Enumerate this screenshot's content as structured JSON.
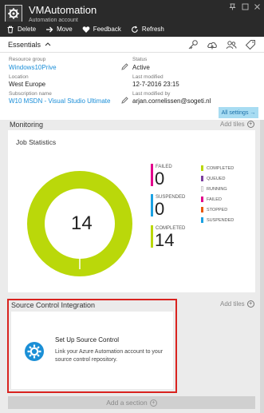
{
  "header": {
    "title": "VMAutomation",
    "subtitle": "Automation account",
    "toolbar": [
      {
        "label": "Delete",
        "icon": "trash-icon"
      },
      {
        "label": "Move",
        "icon": "arrow-right-icon"
      },
      {
        "label": "Feedback",
        "icon": "heart-icon"
      },
      {
        "label": "Refresh",
        "icon": "refresh-icon"
      }
    ]
  },
  "essentials": {
    "label": "Essentials",
    "resource_group_label": "Resource group",
    "resource_group": "Windows10Prive",
    "location_label": "Location",
    "location": "West Europe",
    "subscription_label": "Subscription name",
    "subscription": "W10 MSDN - Visual Studio Ultimate",
    "status_label": "Status",
    "status": "Active",
    "last_modified_label": "Last modified",
    "last_modified": "12-7-2016 23:15",
    "last_modified_by_label": "Last modified by",
    "last_modified_by": "arjan.cornelissen@sogeti.nl",
    "all_settings": "All settings →"
  },
  "monitoring": {
    "title": "Monitoring",
    "add_tiles": "Add tiles",
    "job_statistics": {
      "title": "Job Statistics",
      "total": "14",
      "stats": [
        {
          "label": "FAILED",
          "value": "0",
          "color": "#e3008c"
        },
        {
          "label": "SUSPENDED",
          "value": "0",
          "color": "#1ba1e2"
        },
        {
          "label": "COMPLETED",
          "value": "14",
          "color": "#bad80a"
        }
      ],
      "legend": [
        {
          "label": "COMPLETED",
          "color": "#bad80a"
        },
        {
          "label": "QUEUED",
          "color": "#7b3f9e"
        },
        {
          "label": "RUNNING",
          "color": "#ffffff"
        },
        {
          "label": "FAILED",
          "color": "#e3008c"
        },
        {
          "label": "STOPPED",
          "color": "#e8590c"
        },
        {
          "label": "SUSPENDED",
          "color": "#1ba1e2"
        }
      ]
    }
  },
  "source_control": {
    "title": "Source Control Integration",
    "add_tiles": "Add tiles",
    "tile_title": "Set Up Source Control",
    "tile_desc_1": "Link your Azure Automation account to your",
    "tile_desc_2": "source control repository."
  },
  "add_section": "Add a section"
}
